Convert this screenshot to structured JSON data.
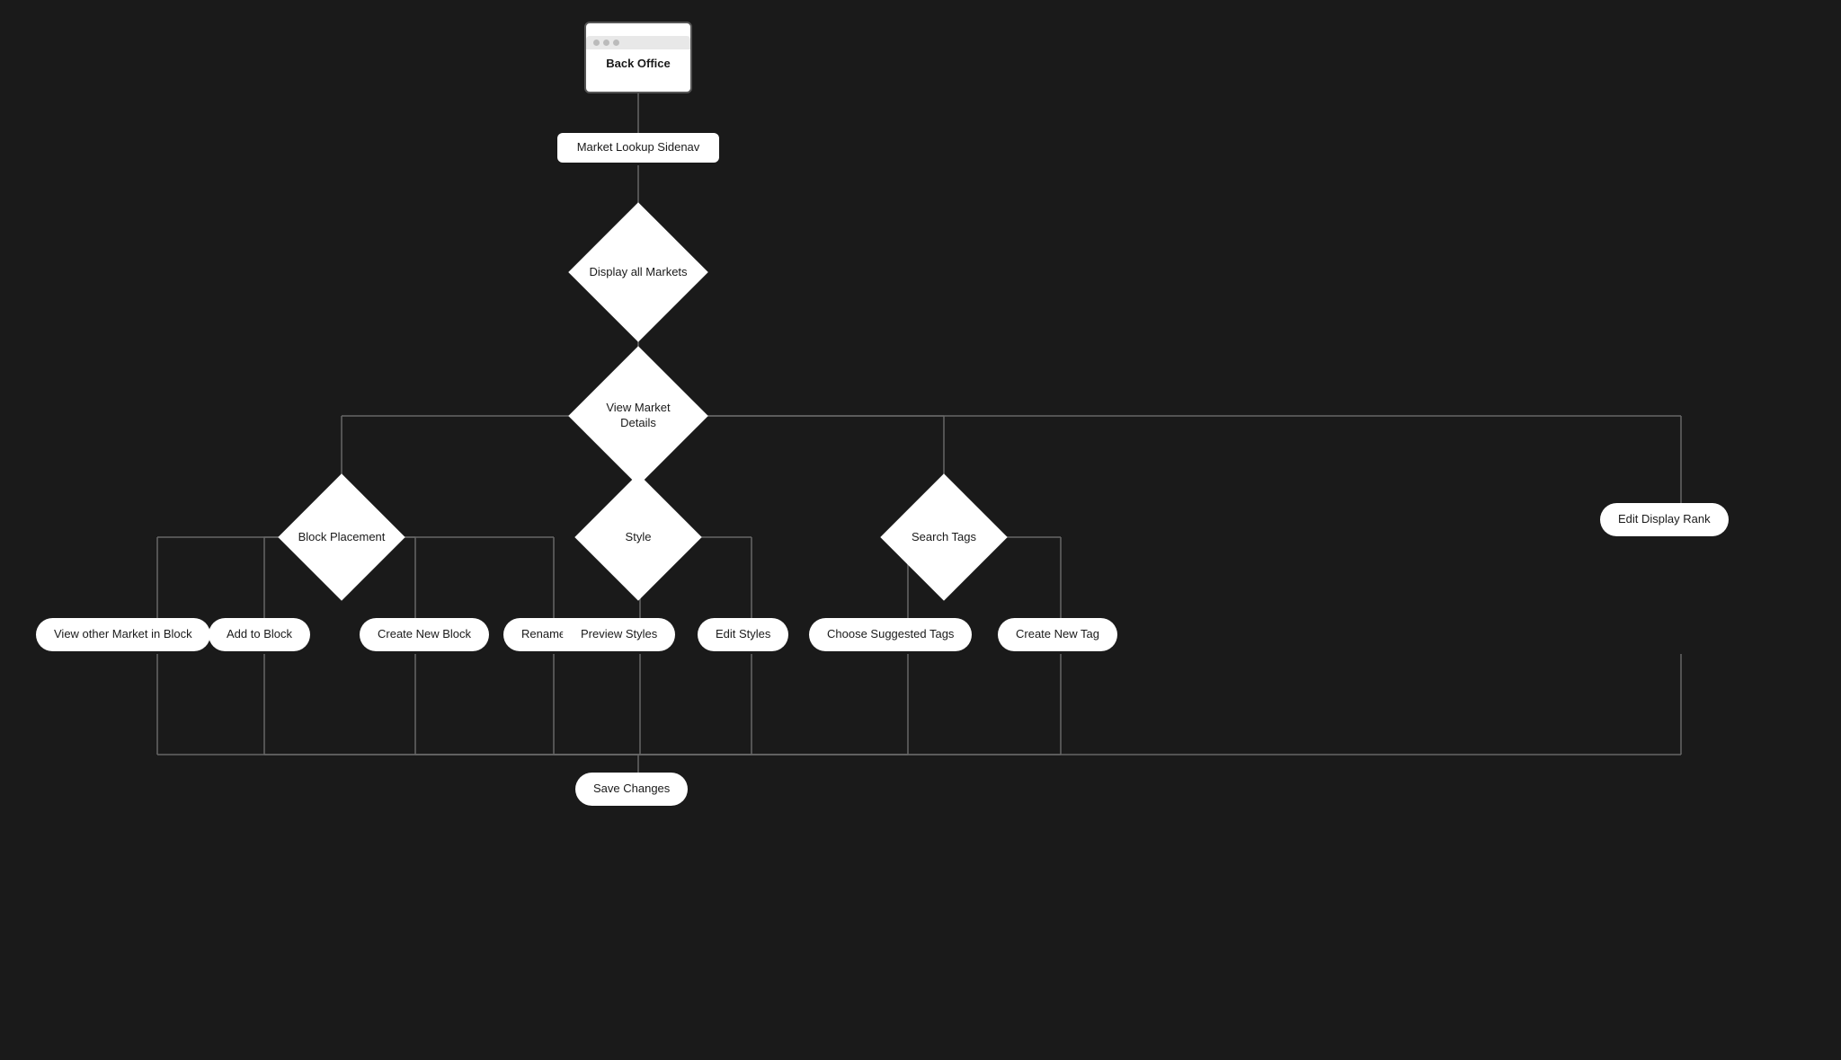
{
  "nodes": {
    "back_office": {
      "label": "Back Office"
    },
    "market_lookup": {
      "label": "Market Lookup Sidenav"
    },
    "display_all": {
      "label": "Display all\nMarkets"
    },
    "view_market": {
      "label": "View Market\nDetails"
    },
    "block_placement": {
      "label": "Block\nPlacement"
    },
    "style": {
      "label": "Style"
    },
    "search_tags": {
      "label": "Search Tags"
    },
    "edit_display_rank": {
      "label": "Edit Display Rank"
    },
    "view_other_market": {
      "label": "View other Market in Block"
    },
    "add_to_block": {
      "label": "Add to Block"
    },
    "create_new_block": {
      "label": "Create New Block"
    },
    "rename_block": {
      "label": "Rename Block"
    },
    "preview_styles": {
      "label": "Preview Styles"
    },
    "edit_styles": {
      "label": "Edit Styles"
    },
    "choose_suggested_tags": {
      "label": "Choose Suggested Tags"
    },
    "create_new_tag": {
      "label": "Create New Tag"
    },
    "save_changes": {
      "label": "Save Changes"
    }
  }
}
